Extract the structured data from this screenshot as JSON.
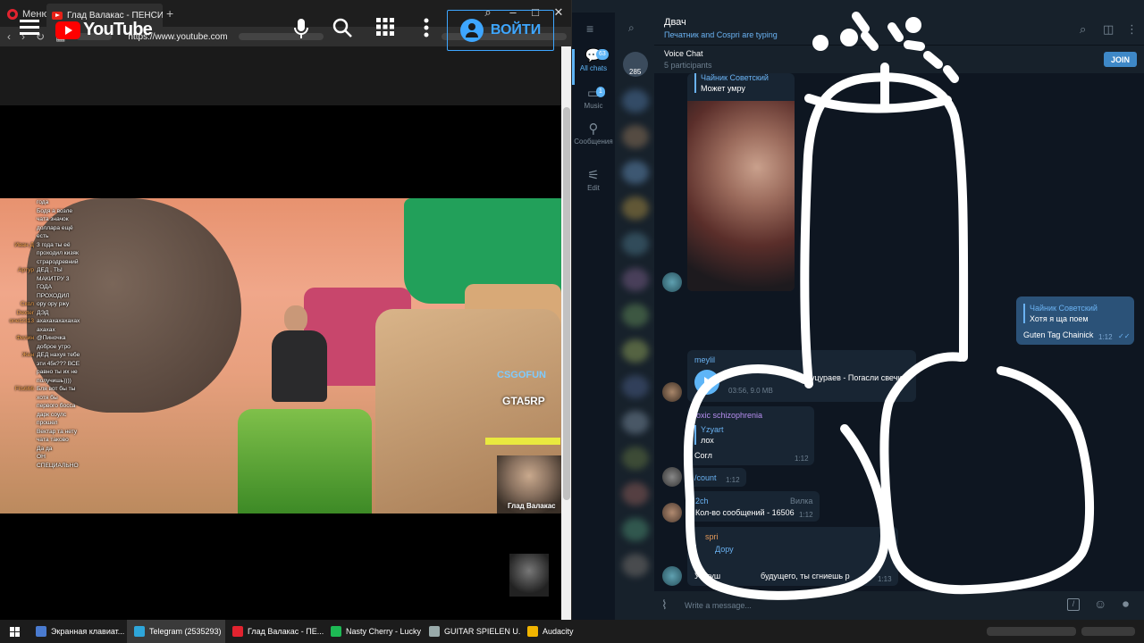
{
  "browser": {
    "menu_label": "Меню",
    "tab_title": "Глад Валакас - ПЕНСИОН",
    "url": "https://www.youtube.com"
  },
  "youtube": {
    "logo_text": "YouTube",
    "login_label": "ВОЙТИ",
    "chat_overlay": [
      {
        "nick": "",
        "msg": "года"
      },
      {
        "nick": "",
        "msg": "Бодя а возле"
      },
      {
        "nick": "",
        "msg": "чата значок"
      },
      {
        "nick": "",
        "msg": "доллара ещё"
      },
      {
        "nick": "",
        "msg": "есть"
      },
      {
        "nick": "Иван Д",
        "msg": "3 года ты её"
      },
      {
        "nick": "",
        "msg": "проходил кизяк"
      },
      {
        "nick": "",
        "msg": "страродревний"
      },
      {
        "nick": "Артур",
        "msg": "ДЕД , ТЫ"
      },
      {
        "nick": "",
        "msg": "МАКИТРУ 3"
      },
      {
        "nick": "",
        "msg": "ГОДА"
      },
      {
        "nick": "",
        "msg": "ПРОХОДИЛ"
      },
      {
        "nick": "Скол",
        "msg": "ору ору ржу"
      },
      {
        "nick": "Dexter",
        "msg": "ДЭД"
      },
      {
        "nick": "onet2313",
        "msg": "ахахахахахахах"
      },
      {
        "nick": "",
        "msg": "ахахах"
      },
      {
        "nick": "Филин",
        "msg": "@Пиночка"
      },
      {
        "nick": "",
        "msg": "доброе утро"
      },
      {
        "nick": "Жен",
        "msg": "ДЕД нахуя тебе"
      },
      {
        "nick": "",
        "msg": "эти 45к??? ВСЕ"
      },
      {
        "nick": "",
        "msg": "равно ты их не"
      },
      {
        "nick": "",
        "msg": "получишь))))"
      },
      {
        "nick": "Fils666",
        "msg": "Бля вот бы ты"
      },
      {
        "nick": "",
        "msg": "хотя бы"
      },
      {
        "nick": "",
        "msg": "первого босса"
      },
      {
        "nick": "",
        "msg": "дарк соулс"
      },
      {
        "nick": "",
        "msg": "прошел"
      },
      {
        "nick": "",
        "msg": "Вектар та нету"
      },
      {
        "nick": "",
        "msg": "чата таково"
      },
      {
        "nick": "",
        "msg": "Да да"
      },
      {
        "nick": "",
        "msg": "ОН"
      },
      {
        "nick": "",
        "msg": "СПЕЦИАЛЬНО"
      }
    ],
    "overlay_csgo": "CSGOFUN",
    "overlay_gta": "GTA5RP",
    "overlay_webcam_label": "Глад Валакас"
  },
  "telegram": {
    "folders": [
      {
        "label": "All chats",
        "badge": "63"
      },
      {
        "label": "Music",
        "badge": "1"
      },
      {
        "label": "Сообщения",
        "badge": ""
      },
      {
        "label": "Edit",
        "badge": ""
      }
    ],
    "chatlist_count": "285",
    "chat_title": "Двач",
    "typing_status": "Печатник and Cospri are typing",
    "voice_chat_title": "Voice Chat",
    "voice_chat_participants": "5 participants",
    "join_label": "JOIN",
    "messages": {
      "m1_reply_name": "Чайник Советский",
      "m1_reply_text": "Может умру",
      "m2_reply_name": "Чайник Советский",
      "m2_reply_text": "Хотя я ща поем",
      "m2_text": "Guten Tag Chainick",
      "m2_time": "1:12",
      "m3_sender": "meylil",
      "m3_track": "уцураев - Погасли свечи",
      "m3_meta": "03:56, 9.0 MB",
      "m4_sender": "oxic schizophrenia",
      "m4_reply_name": "Yzyart",
      "m4_reply_text": "лох",
      "m4_text": "Согл",
      "m4_time": "1:12",
      "m5_text": "/count",
      "m5_time": "1:12",
      "m6_sender": "2ch",
      "m6_via": "Вилка",
      "m6_text": "Кол-во сообщений - 16506",
      "m6_time": "1:12",
      "m7_sender": "spri",
      "m7_reply_name": "Дору",
      "m7_text": "У птуш",
      "m7_text_tail": "будущего, ты сгниешь р",
      "m7_time": "1:13"
    },
    "input_placeholder": "Write a message..."
  },
  "taskbar": [
    {
      "label": "Экранная клавиат...",
      "color": "#4a7bd0"
    },
    {
      "label": "Telegram (2535293)",
      "color": "#2ea6da"
    },
    {
      "label": "Глад Валакас - ПЕ...",
      "color": "#e2232f"
    },
    {
      "label": "Nasty Cherry - Lucky",
      "color": "#1db954"
    },
    {
      "label": "GUITAR SPIELEN U...",
      "color": "#9aa"
    },
    {
      "label": "Audacity",
      "color": "#f0b400"
    }
  ],
  "colors": {
    "tg_bg": "#0e1621",
    "tg_panel": "#17212b",
    "tg_accent": "#5eb5f7",
    "yt_red": "#ff0000",
    "yt_login_blue": "#3ea6ff",
    "drawing_stroke": "#ffffff"
  }
}
